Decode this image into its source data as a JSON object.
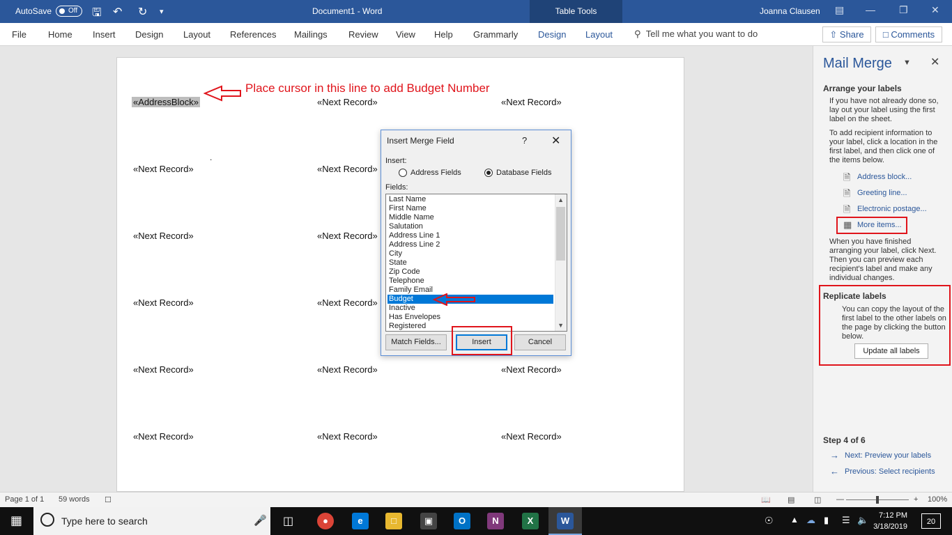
{
  "titlebar": {
    "autosave_label": "AutoSave",
    "autosave_state": "Off",
    "doc_title": "Document1  -  Word",
    "context_tab": "Table Tools",
    "user": "Joanna Clausen"
  },
  "ribbon": {
    "tabs": [
      "File",
      "Home",
      "Insert",
      "Design",
      "Layout",
      "References",
      "Mailings",
      "Review",
      "View",
      "Help",
      "Grammarly",
      "Design",
      "Layout"
    ],
    "tell_me": "Tell me what you want to do",
    "share": "Share",
    "comments": "Comments"
  },
  "document": {
    "annotation": "Place cursor in this line to add Budget Number",
    "address_block": "«AddressBlock»",
    "next_record": "«Next Record»"
  },
  "dialog": {
    "title": "Insert Merge Field",
    "help": "?",
    "insert_label": "Insert:",
    "address_fields": "Address Fields",
    "database_fields": "Database Fields",
    "fields_label": "Fields:",
    "fields": [
      "Last Name",
      "First Name",
      "Middle Name",
      "Salutation",
      "Address Line 1",
      "Address Line 2",
      "City",
      "State",
      "Zip Code",
      "Telephone",
      "Family Email",
      "Budget",
      "Inactive",
      "Has Envelopes",
      "Registered"
    ],
    "selected_field": "Budget",
    "match_fields": "Match Fields...",
    "insert": "Insert",
    "cancel": "Cancel"
  },
  "pane": {
    "title": "Mail Merge",
    "arrange_heading": "Arrange your labels",
    "arrange_text1": "If you have not already done so, lay out your label using the first label on the sheet.",
    "arrange_text2": "To add recipient information to your label, click a location in the first label, and then click one of the items below.",
    "links": [
      "Address block...",
      "Greeting line...",
      "Electronic postage...",
      "More items..."
    ],
    "finished_text": "When you have finished arranging your label, click Next. Then you can preview each recipient's label and make any individual changes.",
    "replicate_heading": "Replicate labels",
    "replicate_text": "You can copy the layout of the first label to the other labels on the page by clicking the button below.",
    "update_button": "Update all labels",
    "step": "Step 4 of 6",
    "next": "Next: Preview your labels",
    "previous": "Previous: Select recipients"
  },
  "statusbar": {
    "page": "Page 1 of 1",
    "words": "59 words",
    "zoom": "100%"
  },
  "taskbar": {
    "search_placeholder": "Type here to search",
    "time": "7:12 PM",
    "date": "3/18/2019",
    "notifications": "20"
  },
  "colors": {
    "word_blue": "#2b579a",
    "annotation_red": "#e0141b",
    "selection_blue": "#0078d7"
  }
}
